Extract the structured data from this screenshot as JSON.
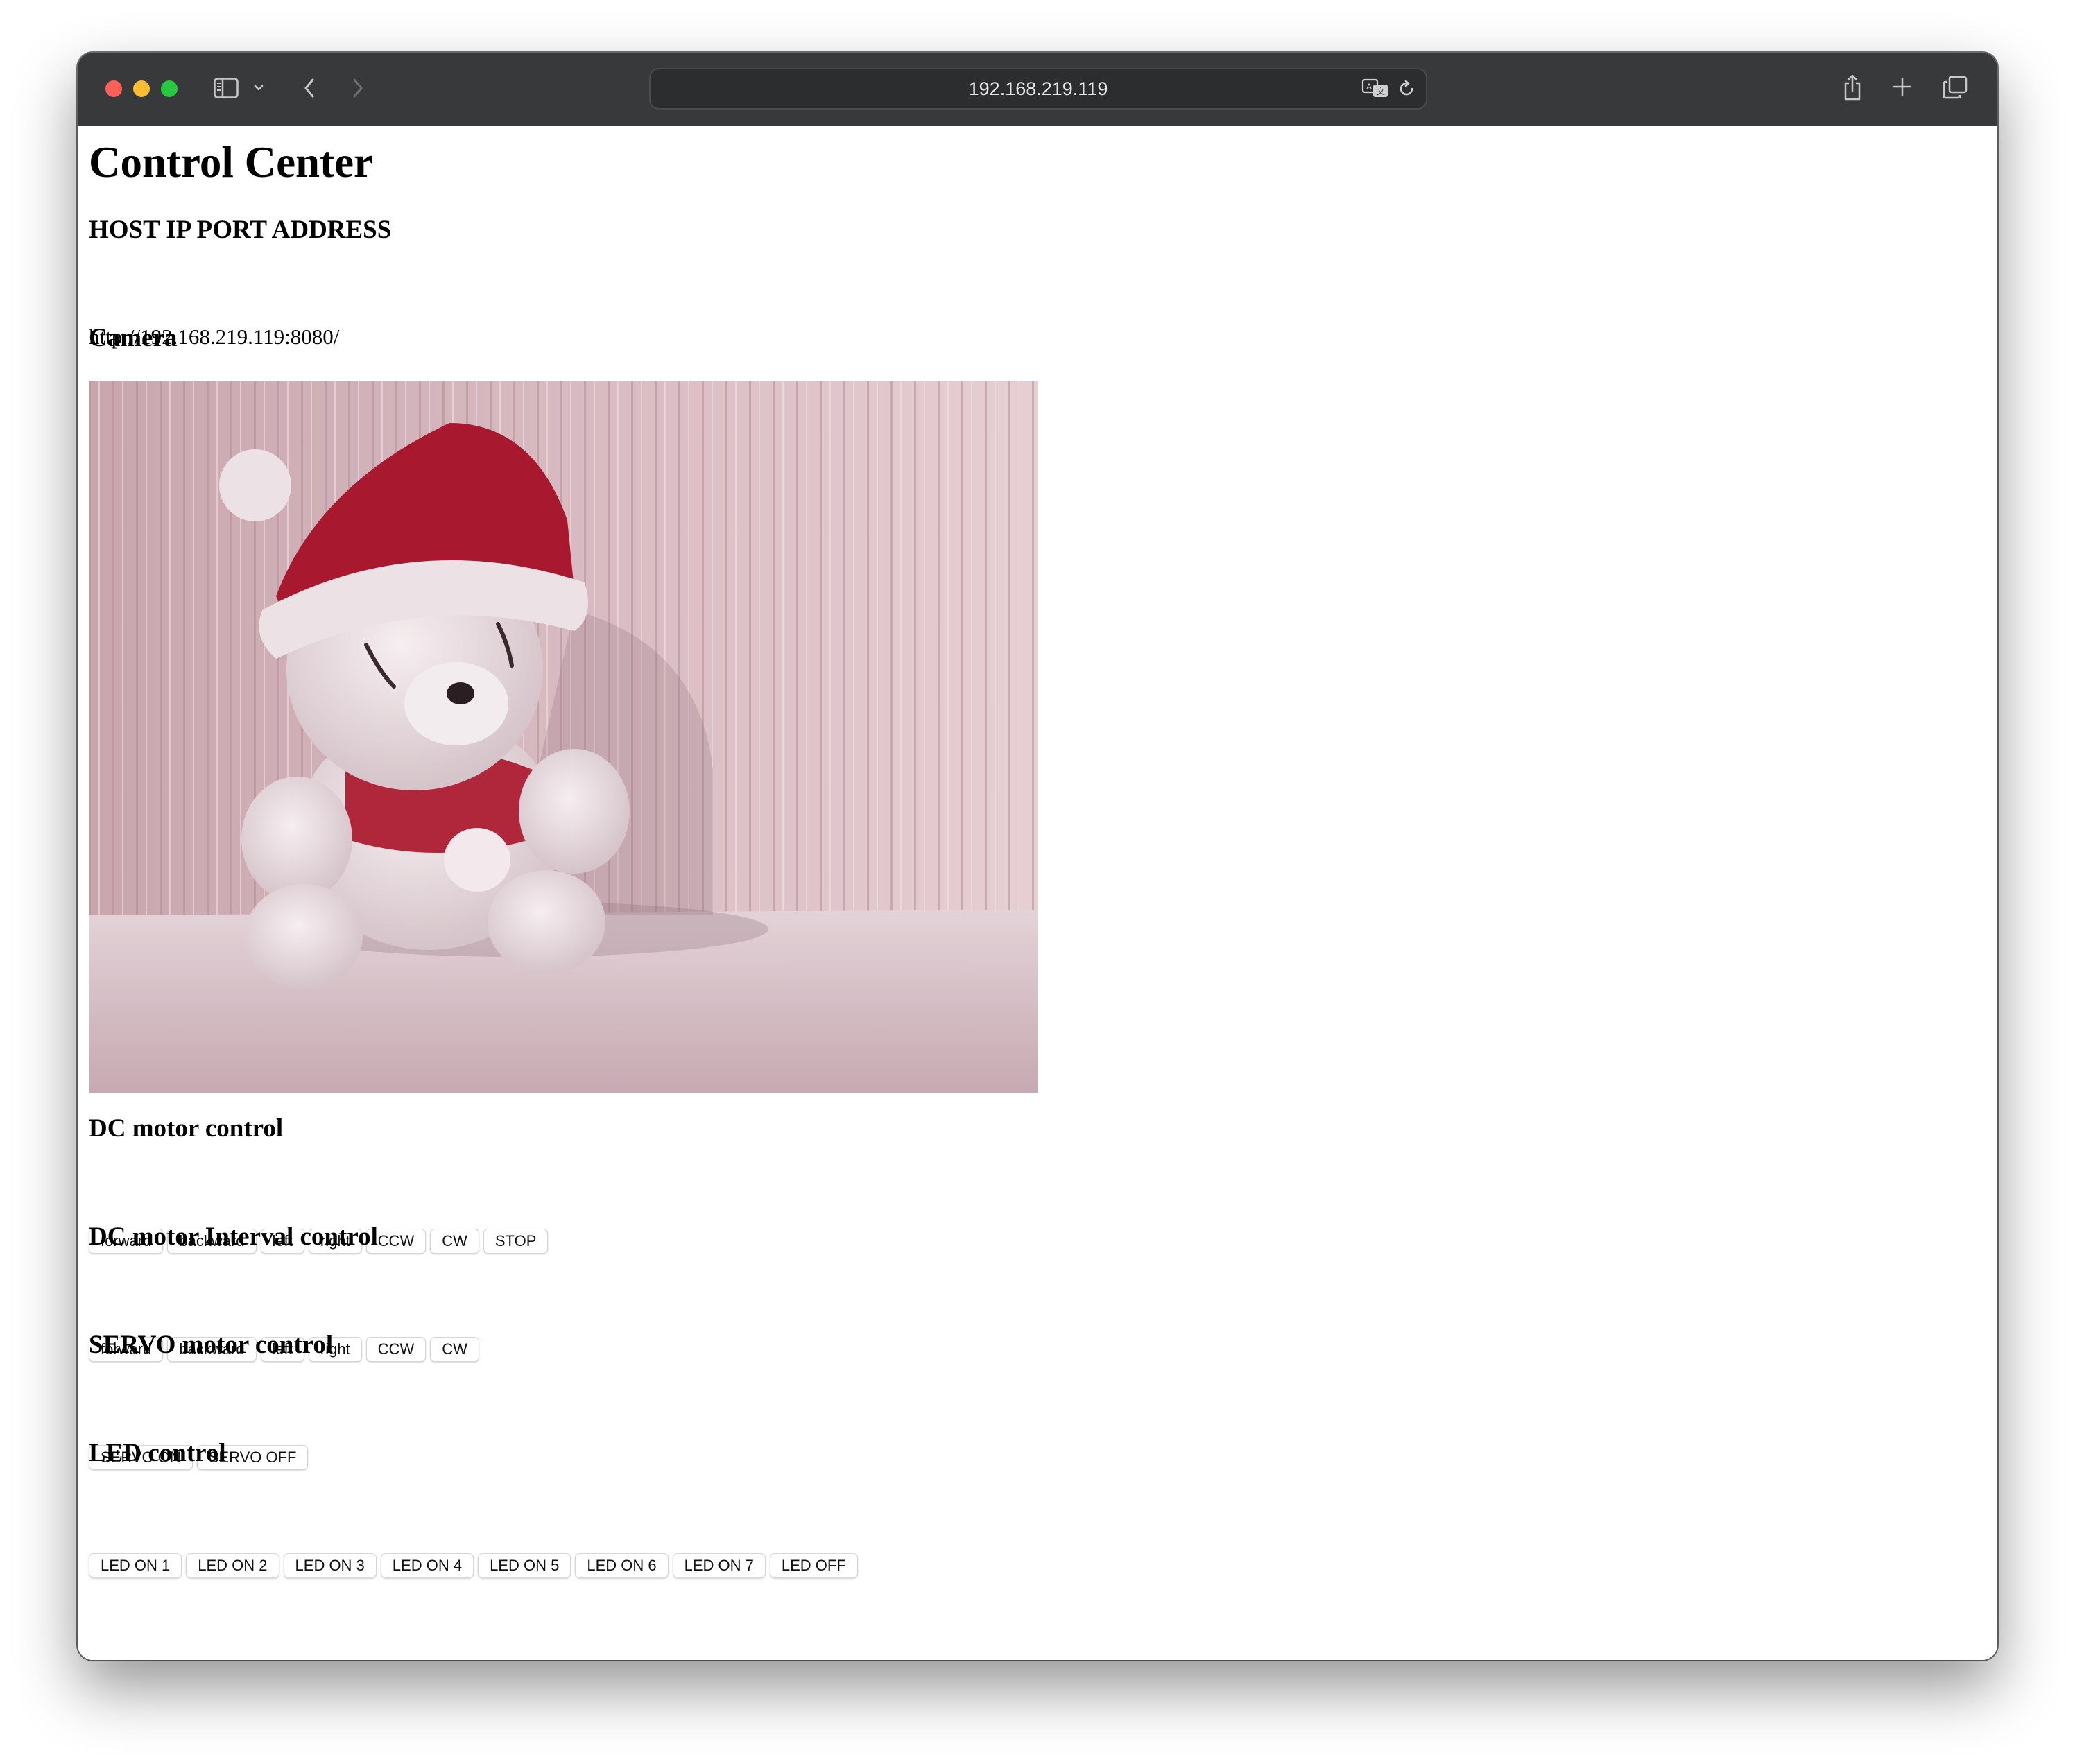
{
  "browser": {
    "address": "192.168.219.119",
    "icons": {
      "sidebar": "sidebar-icon",
      "chevron": "chevron-down-icon",
      "back": "back-arrow-icon",
      "forward": "forward-arrow-icon",
      "translate": "translate-icon",
      "reload": "reload-icon",
      "share": "share-icon",
      "new_tab": "plus-icon",
      "tabs": "tab-overview-icon"
    }
  },
  "page": {
    "title": "Control Center",
    "host_heading": "HOST IP PORT ADDRESS",
    "host_url": "http://192.168.219.119:8080/",
    "camera_heading": "Camera",
    "dc_heading": "DC motor control",
    "dc_buttons": [
      "forward",
      "backward",
      "left",
      "right",
      "CCW",
      "CW",
      "STOP"
    ],
    "interval_heading": "DC motor Interval control",
    "interval_buttons": [
      "forward",
      "backward",
      "left",
      "right",
      "CCW",
      "CW"
    ],
    "servo_heading": "SERVO motor control",
    "servo_buttons": [
      "SERVO ON",
      "SERVO OFF"
    ],
    "led_heading": "LED control",
    "led_buttons": [
      "LED ON 1",
      "LED ON 2",
      "LED ON 3",
      "LED ON 4",
      "LED ON 5",
      "LED ON 6",
      "LED ON 7",
      "LED OFF"
    ]
  }
}
